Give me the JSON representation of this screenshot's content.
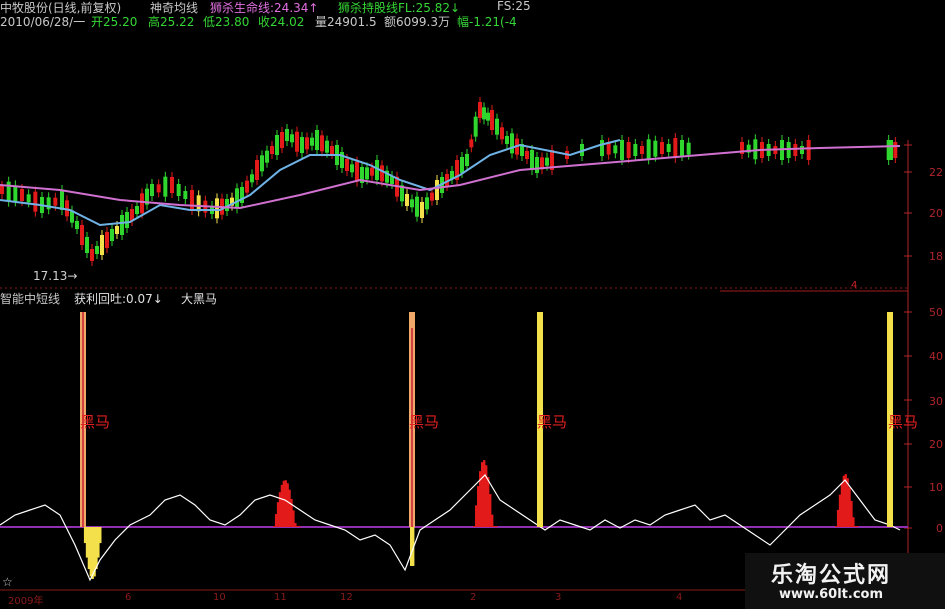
{
  "header": {
    "stock": "中牧股份(日线,前复权)",
    "indicator": "神奇均线",
    "life_line": "狮杀生命线:24.34↑",
    "hold_line": "狮杀持股线FL:25.82↓",
    "fs": "FS:25",
    "date": "2010/06/28/一",
    "open": "开25.20",
    "high": "高25.22",
    "low": "低23.80",
    "close": "收24.02",
    "volume": "量24901.5",
    "amount": "额6099.3万",
    "change": "幅-1.21(-4"
  },
  "main_chart": {
    "low_label": "17.13",
    "price_axis": [
      "22",
      "20",
      "18"
    ]
  },
  "sub_chart": {
    "title": "智能中短线",
    "profit_label": "获利回吐:0.07↓",
    "signal_label": "大黑马",
    "value_axis": [
      "50",
      "40",
      "30",
      "20",
      "10",
      "0"
    ],
    "signals": [
      "黑马",
      "黑马",
      "黑马",
      "黑马"
    ],
    "top_marker": "4"
  },
  "bottom": {
    "star": "☆",
    "year": "2009年",
    "months": [
      "6",
      "10",
      "11",
      "12",
      "2",
      "3",
      "4"
    ]
  },
  "watermark": {
    "title": "乐淘公式网",
    "url": "www.60lt.com"
  },
  "colors": {
    "up": "#e31a1a",
    "down": "#2ed62e",
    "avg_blue": "#6fb3e6",
    "avg_magenta": "#d070d0",
    "signal_yellow": "#f4e04a",
    "signal_orange": "#f0a868",
    "axis_red": "#b0252a"
  }
}
